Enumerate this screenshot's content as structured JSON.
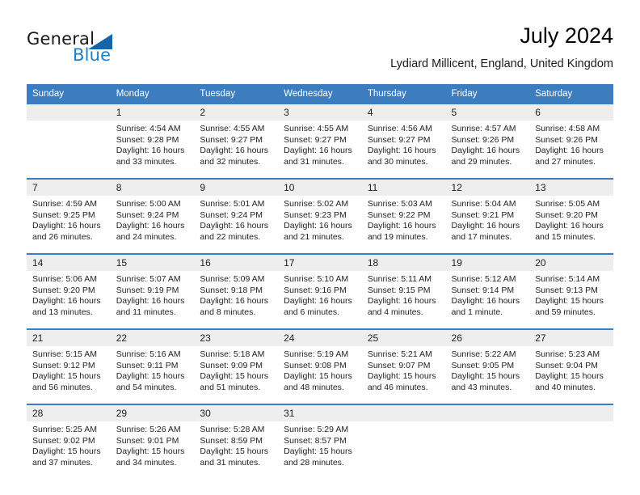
{
  "logo": {
    "word1": "General",
    "word2": "Blue",
    "triangle_color": "#1565a8",
    "blue_color": "#1f7fc4"
  },
  "header": {
    "title": "July 2024",
    "subtitle": "Lydiard Millicent, England, United Kingdom"
  },
  "theme": {
    "header_bg": "#3b7dbf",
    "daynum_bg": "#eeeeee",
    "text": "#222222"
  },
  "calendar": {
    "weekday_headers": [
      "Sunday",
      "Monday",
      "Tuesday",
      "Wednesday",
      "Thursday",
      "Friday",
      "Saturday"
    ],
    "weeks": [
      [
        {
          "day": "",
          "lines": []
        },
        {
          "day": "1",
          "lines": [
            "Sunrise: 4:54 AM",
            "Sunset: 9:28 PM",
            "Daylight: 16 hours",
            "and 33 minutes."
          ]
        },
        {
          "day": "2",
          "lines": [
            "Sunrise: 4:55 AM",
            "Sunset: 9:27 PM",
            "Daylight: 16 hours",
            "and 32 minutes."
          ]
        },
        {
          "day": "3",
          "lines": [
            "Sunrise: 4:55 AM",
            "Sunset: 9:27 PM",
            "Daylight: 16 hours",
            "and 31 minutes."
          ]
        },
        {
          "day": "4",
          "lines": [
            "Sunrise: 4:56 AM",
            "Sunset: 9:27 PM",
            "Daylight: 16 hours",
            "and 30 minutes."
          ]
        },
        {
          "day": "5",
          "lines": [
            "Sunrise: 4:57 AM",
            "Sunset: 9:26 PM",
            "Daylight: 16 hours",
            "and 29 minutes."
          ]
        },
        {
          "day": "6",
          "lines": [
            "Sunrise: 4:58 AM",
            "Sunset: 9:26 PM",
            "Daylight: 16 hours",
            "and 27 minutes."
          ]
        }
      ],
      [
        {
          "day": "7",
          "lines": [
            "Sunrise: 4:59 AM",
            "Sunset: 9:25 PM",
            "Daylight: 16 hours",
            "and 26 minutes."
          ]
        },
        {
          "day": "8",
          "lines": [
            "Sunrise: 5:00 AM",
            "Sunset: 9:24 PM",
            "Daylight: 16 hours",
            "and 24 minutes."
          ]
        },
        {
          "day": "9",
          "lines": [
            "Sunrise: 5:01 AM",
            "Sunset: 9:24 PM",
            "Daylight: 16 hours",
            "and 22 minutes."
          ]
        },
        {
          "day": "10",
          "lines": [
            "Sunrise: 5:02 AM",
            "Sunset: 9:23 PM",
            "Daylight: 16 hours",
            "and 21 minutes."
          ]
        },
        {
          "day": "11",
          "lines": [
            "Sunrise: 5:03 AM",
            "Sunset: 9:22 PM",
            "Daylight: 16 hours",
            "and 19 minutes."
          ]
        },
        {
          "day": "12",
          "lines": [
            "Sunrise: 5:04 AM",
            "Sunset: 9:21 PM",
            "Daylight: 16 hours",
            "and 17 minutes."
          ]
        },
        {
          "day": "13",
          "lines": [
            "Sunrise: 5:05 AM",
            "Sunset: 9:20 PM",
            "Daylight: 16 hours",
            "and 15 minutes."
          ]
        }
      ],
      [
        {
          "day": "14",
          "lines": [
            "Sunrise: 5:06 AM",
            "Sunset: 9:20 PM",
            "Daylight: 16 hours",
            "and 13 minutes."
          ]
        },
        {
          "day": "15",
          "lines": [
            "Sunrise: 5:07 AM",
            "Sunset: 9:19 PM",
            "Daylight: 16 hours",
            "and 11 minutes."
          ]
        },
        {
          "day": "16",
          "lines": [
            "Sunrise: 5:09 AM",
            "Sunset: 9:18 PM",
            "Daylight: 16 hours",
            "and 8 minutes."
          ]
        },
        {
          "day": "17",
          "lines": [
            "Sunrise: 5:10 AM",
            "Sunset: 9:16 PM",
            "Daylight: 16 hours",
            "and 6 minutes."
          ]
        },
        {
          "day": "18",
          "lines": [
            "Sunrise: 5:11 AM",
            "Sunset: 9:15 PM",
            "Daylight: 16 hours",
            "and 4 minutes."
          ]
        },
        {
          "day": "19",
          "lines": [
            "Sunrise: 5:12 AM",
            "Sunset: 9:14 PM",
            "Daylight: 16 hours",
            "and 1 minute."
          ]
        },
        {
          "day": "20",
          "lines": [
            "Sunrise: 5:14 AM",
            "Sunset: 9:13 PM",
            "Daylight: 15 hours",
            "and 59 minutes."
          ]
        }
      ],
      [
        {
          "day": "21",
          "lines": [
            "Sunrise: 5:15 AM",
            "Sunset: 9:12 PM",
            "Daylight: 15 hours",
            "and 56 minutes."
          ]
        },
        {
          "day": "22",
          "lines": [
            "Sunrise: 5:16 AM",
            "Sunset: 9:11 PM",
            "Daylight: 15 hours",
            "and 54 minutes."
          ]
        },
        {
          "day": "23",
          "lines": [
            "Sunrise: 5:18 AM",
            "Sunset: 9:09 PM",
            "Daylight: 15 hours",
            "and 51 minutes."
          ]
        },
        {
          "day": "24",
          "lines": [
            "Sunrise: 5:19 AM",
            "Sunset: 9:08 PM",
            "Daylight: 15 hours",
            "and 48 minutes."
          ]
        },
        {
          "day": "25",
          "lines": [
            "Sunrise: 5:21 AM",
            "Sunset: 9:07 PM",
            "Daylight: 15 hours",
            "and 46 minutes."
          ]
        },
        {
          "day": "26",
          "lines": [
            "Sunrise: 5:22 AM",
            "Sunset: 9:05 PM",
            "Daylight: 15 hours",
            "and 43 minutes."
          ]
        },
        {
          "day": "27",
          "lines": [
            "Sunrise: 5:23 AM",
            "Sunset: 9:04 PM",
            "Daylight: 15 hours",
            "and 40 minutes."
          ]
        }
      ],
      [
        {
          "day": "28",
          "lines": [
            "Sunrise: 5:25 AM",
            "Sunset: 9:02 PM",
            "Daylight: 15 hours",
            "and 37 minutes."
          ]
        },
        {
          "day": "29",
          "lines": [
            "Sunrise: 5:26 AM",
            "Sunset: 9:01 PM",
            "Daylight: 15 hours",
            "and 34 minutes."
          ]
        },
        {
          "day": "30",
          "lines": [
            "Sunrise: 5:28 AM",
            "Sunset: 8:59 PM",
            "Daylight: 15 hours",
            "and 31 minutes."
          ]
        },
        {
          "day": "31",
          "lines": [
            "Sunrise: 5:29 AM",
            "Sunset: 8:57 PM",
            "Daylight: 15 hours",
            "and 28 minutes."
          ]
        },
        {
          "day": "",
          "lines": []
        },
        {
          "day": "",
          "lines": []
        },
        {
          "day": "",
          "lines": []
        }
      ]
    ]
  }
}
